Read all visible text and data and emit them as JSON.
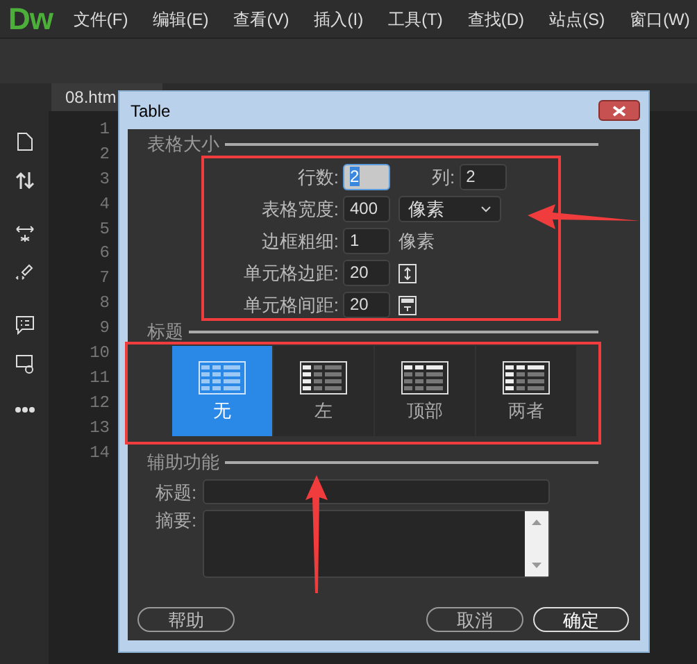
{
  "app": {
    "logo": "Dw",
    "menu": [
      "文件(F)",
      "编辑(E)",
      "查看(V)",
      "插入(I)",
      "工具(T)",
      "查找(D)",
      "站点(S)",
      "窗口(W)"
    ]
  },
  "document_tab": {
    "label": "08.htm"
  },
  "line_numbers": [
    "1",
    "2",
    "3",
    "4",
    "5",
    "6",
    "7",
    "8",
    "9",
    "10",
    "11",
    "12",
    "13",
    "14"
  ],
  "dialog": {
    "title": "Table",
    "size_group": {
      "label": "表格大小",
      "rows": {
        "label": "行数:",
        "value": "2"
      },
      "columns": {
        "label": "列:",
        "value": "2"
      },
      "width": {
        "label": "表格宽度:",
        "value": "400",
        "unit": "像素"
      },
      "border": {
        "label": "边框粗细:",
        "value": "1",
        "unit": "像素"
      },
      "padding": {
        "label": "单元格边距:",
        "value": "20"
      },
      "spacing": {
        "label": "单元格间距:",
        "value": "20"
      }
    },
    "header_group": {
      "label": "标题",
      "options": [
        {
          "label": "无",
          "kind": "none",
          "selected": true
        },
        {
          "label": "左",
          "kind": "left",
          "selected": false
        },
        {
          "label": "顶部",
          "kind": "top",
          "selected": false
        },
        {
          "label": "两者",
          "kind": "both",
          "selected": false
        }
      ]
    },
    "accessibility_group": {
      "label": "辅助功能",
      "caption": {
        "label": "标题:"
      },
      "summary": {
        "label": "摘要:"
      }
    },
    "buttons": {
      "help": "帮助",
      "cancel": "取消",
      "ok": "确定"
    }
  }
}
